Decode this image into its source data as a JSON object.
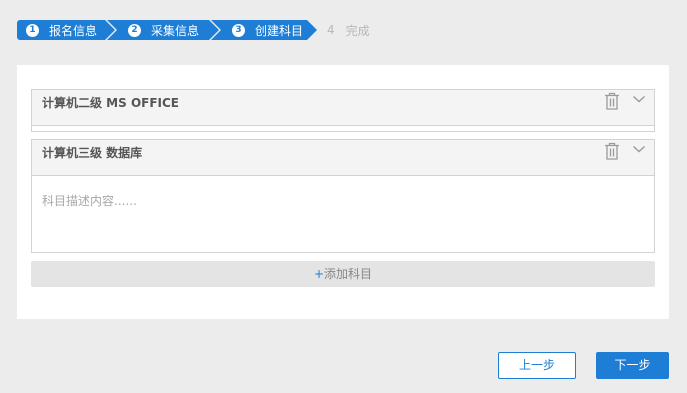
{
  "stepper": {
    "steps": [
      {
        "num": "1",
        "label": "报名信息"
      },
      {
        "num": "2",
        "label": "采集信息"
      },
      {
        "num": "3",
        "label": "创建科目"
      },
      {
        "num": "4",
        "label": "完成"
      }
    ]
  },
  "subjects": [
    {
      "title": "计算机二级 MS OFFICE"
    },
    {
      "title": "计算机三级 数据库",
      "description_placeholder": "科目描述内容......"
    }
  ],
  "add_subject": {
    "plus": "+",
    "label": "添加科目"
  },
  "footer": {
    "prev_label": "上一步",
    "next_label": "下一步"
  },
  "colors": {
    "accent": "#1e7ed6",
    "background": "#ececec",
    "disabled_step": "#b8b8b8"
  },
  "icons": {
    "delete": "trash-icon",
    "expand": "chevron-down-icon"
  }
}
